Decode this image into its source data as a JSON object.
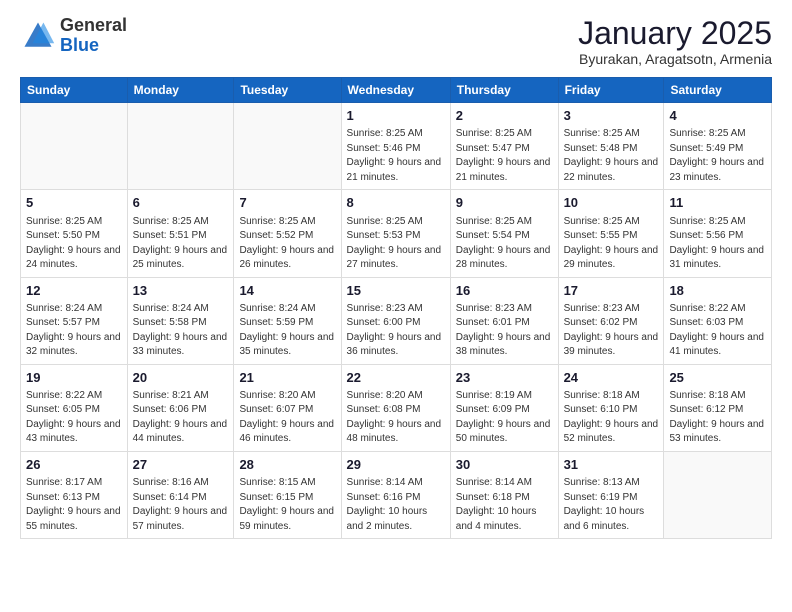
{
  "header": {
    "logo_general": "General",
    "logo_blue": "Blue",
    "month_title": "January 2025",
    "subtitle": "Byurakan, Aragatsotn, Armenia"
  },
  "days_of_week": [
    "Sunday",
    "Monday",
    "Tuesday",
    "Wednesday",
    "Thursday",
    "Friday",
    "Saturday"
  ],
  "weeks": [
    [
      {
        "day": "",
        "info": ""
      },
      {
        "day": "",
        "info": ""
      },
      {
        "day": "",
        "info": ""
      },
      {
        "day": "1",
        "info": "Sunrise: 8:25 AM\nSunset: 5:46 PM\nDaylight: 9 hours\nand 21 minutes."
      },
      {
        "day": "2",
        "info": "Sunrise: 8:25 AM\nSunset: 5:47 PM\nDaylight: 9 hours\nand 21 minutes."
      },
      {
        "day": "3",
        "info": "Sunrise: 8:25 AM\nSunset: 5:48 PM\nDaylight: 9 hours\nand 22 minutes."
      },
      {
        "day": "4",
        "info": "Sunrise: 8:25 AM\nSunset: 5:49 PM\nDaylight: 9 hours\nand 23 minutes."
      }
    ],
    [
      {
        "day": "5",
        "info": "Sunrise: 8:25 AM\nSunset: 5:50 PM\nDaylight: 9 hours\nand 24 minutes."
      },
      {
        "day": "6",
        "info": "Sunrise: 8:25 AM\nSunset: 5:51 PM\nDaylight: 9 hours\nand 25 minutes."
      },
      {
        "day": "7",
        "info": "Sunrise: 8:25 AM\nSunset: 5:52 PM\nDaylight: 9 hours\nand 26 minutes."
      },
      {
        "day": "8",
        "info": "Sunrise: 8:25 AM\nSunset: 5:53 PM\nDaylight: 9 hours\nand 27 minutes."
      },
      {
        "day": "9",
        "info": "Sunrise: 8:25 AM\nSunset: 5:54 PM\nDaylight: 9 hours\nand 28 minutes."
      },
      {
        "day": "10",
        "info": "Sunrise: 8:25 AM\nSunset: 5:55 PM\nDaylight: 9 hours\nand 29 minutes."
      },
      {
        "day": "11",
        "info": "Sunrise: 8:25 AM\nSunset: 5:56 PM\nDaylight: 9 hours\nand 31 minutes."
      }
    ],
    [
      {
        "day": "12",
        "info": "Sunrise: 8:24 AM\nSunset: 5:57 PM\nDaylight: 9 hours\nand 32 minutes."
      },
      {
        "day": "13",
        "info": "Sunrise: 8:24 AM\nSunset: 5:58 PM\nDaylight: 9 hours\nand 33 minutes."
      },
      {
        "day": "14",
        "info": "Sunrise: 8:24 AM\nSunset: 5:59 PM\nDaylight: 9 hours\nand 35 minutes."
      },
      {
        "day": "15",
        "info": "Sunrise: 8:23 AM\nSunset: 6:00 PM\nDaylight: 9 hours\nand 36 minutes."
      },
      {
        "day": "16",
        "info": "Sunrise: 8:23 AM\nSunset: 6:01 PM\nDaylight: 9 hours\nand 38 minutes."
      },
      {
        "day": "17",
        "info": "Sunrise: 8:23 AM\nSunset: 6:02 PM\nDaylight: 9 hours\nand 39 minutes."
      },
      {
        "day": "18",
        "info": "Sunrise: 8:22 AM\nSunset: 6:03 PM\nDaylight: 9 hours\nand 41 minutes."
      }
    ],
    [
      {
        "day": "19",
        "info": "Sunrise: 8:22 AM\nSunset: 6:05 PM\nDaylight: 9 hours\nand 43 minutes."
      },
      {
        "day": "20",
        "info": "Sunrise: 8:21 AM\nSunset: 6:06 PM\nDaylight: 9 hours\nand 44 minutes."
      },
      {
        "day": "21",
        "info": "Sunrise: 8:20 AM\nSunset: 6:07 PM\nDaylight: 9 hours\nand 46 minutes."
      },
      {
        "day": "22",
        "info": "Sunrise: 8:20 AM\nSunset: 6:08 PM\nDaylight: 9 hours\nand 48 minutes."
      },
      {
        "day": "23",
        "info": "Sunrise: 8:19 AM\nSunset: 6:09 PM\nDaylight: 9 hours\nand 50 minutes."
      },
      {
        "day": "24",
        "info": "Sunrise: 8:18 AM\nSunset: 6:10 PM\nDaylight: 9 hours\nand 52 minutes."
      },
      {
        "day": "25",
        "info": "Sunrise: 8:18 AM\nSunset: 6:12 PM\nDaylight: 9 hours\nand 53 minutes."
      }
    ],
    [
      {
        "day": "26",
        "info": "Sunrise: 8:17 AM\nSunset: 6:13 PM\nDaylight: 9 hours\nand 55 minutes."
      },
      {
        "day": "27",
        "info": "Sunrise: 8:16 AM\nSunset: 6:14 PM\nDaylight: 9 hours\nand 57 minutes."
      },
      {
        "day": "28",
        "info": "Sunrise: 8:15 AM\nSunset: 6:15 PM\nDaylight: 9 hours\nand 59 minutes."
      },
      {
        "day": "29",
        "info": "Sunrise: 8:14 AM\nSunset: 6:16 PM\nDaylight: 10 hours\nand 2 minutes."
      },
      {
        "day": "30",
        "info": "Sunrise: 8:14 AM\nSunset: 6:18 PM\nDaylight: 10 hours\nand 4 minutes."
      },
      {
        "day": "31",
        "info": "Sunrise: 8:13 AM\nSunset: 6:19 PM\nDaylight: 10 hours\nand 6 minutes."
      },
      {
        "day": "",
        "info": ""
      }
    ]
  ]
}
